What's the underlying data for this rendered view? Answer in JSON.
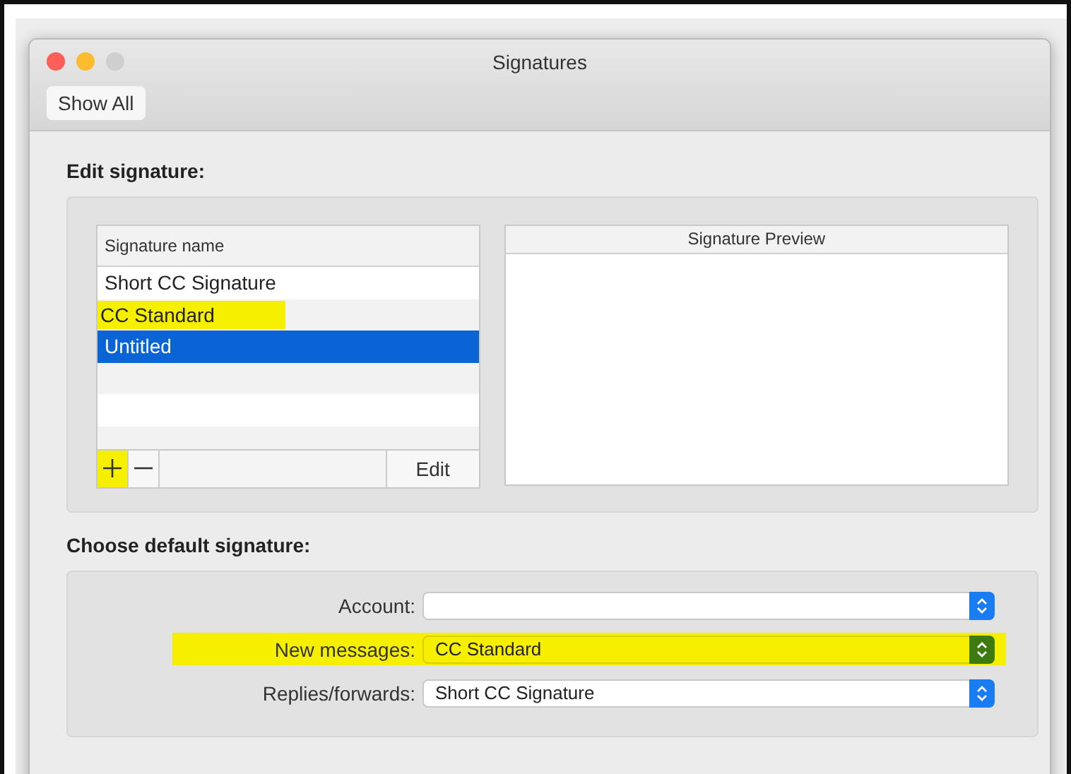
{
  "window": {
    "title": "Signatures"
  },
  "toolbar": {
    "show_all": "Show All"
  },
  "edit_section": {
    "title": "Edit signature:",
    "list": {
      "column": "Signature name",
      "rows": [
        {
          "name": "Short CC Signature",
          "selected": false,
          "highlighted": false
        },
        {
          "name": "CC Standard",
          "selected": false,
          "highlighted": true
        },
        {
          "name": "Untitled",
          "selected": true,
          "highlighted": false
        }
      ],
      "buttons": [
        {
          "kind": "add",
          "highlighted": true
        },
        {
          "kind": "remove",
          "highlighted": false
        }
      ],
      "edit_button": "Edit"
    },
    "preview": {
      "title": "Signature Preview"
    }
  },
  "default_section": {
    "title": "Choose default signature:",
    "fields": [
      {
        "label": "Account:",
        "highlighted": false
      },
      {
        "label": "New messages:",
        "value": "CC Standard",
        "highlighted": true
      },
      {
        "label": "Replies/forwards:",
        "value": "Short CC Signature",
        "highlighted": false
      }
    ]
  }
}
